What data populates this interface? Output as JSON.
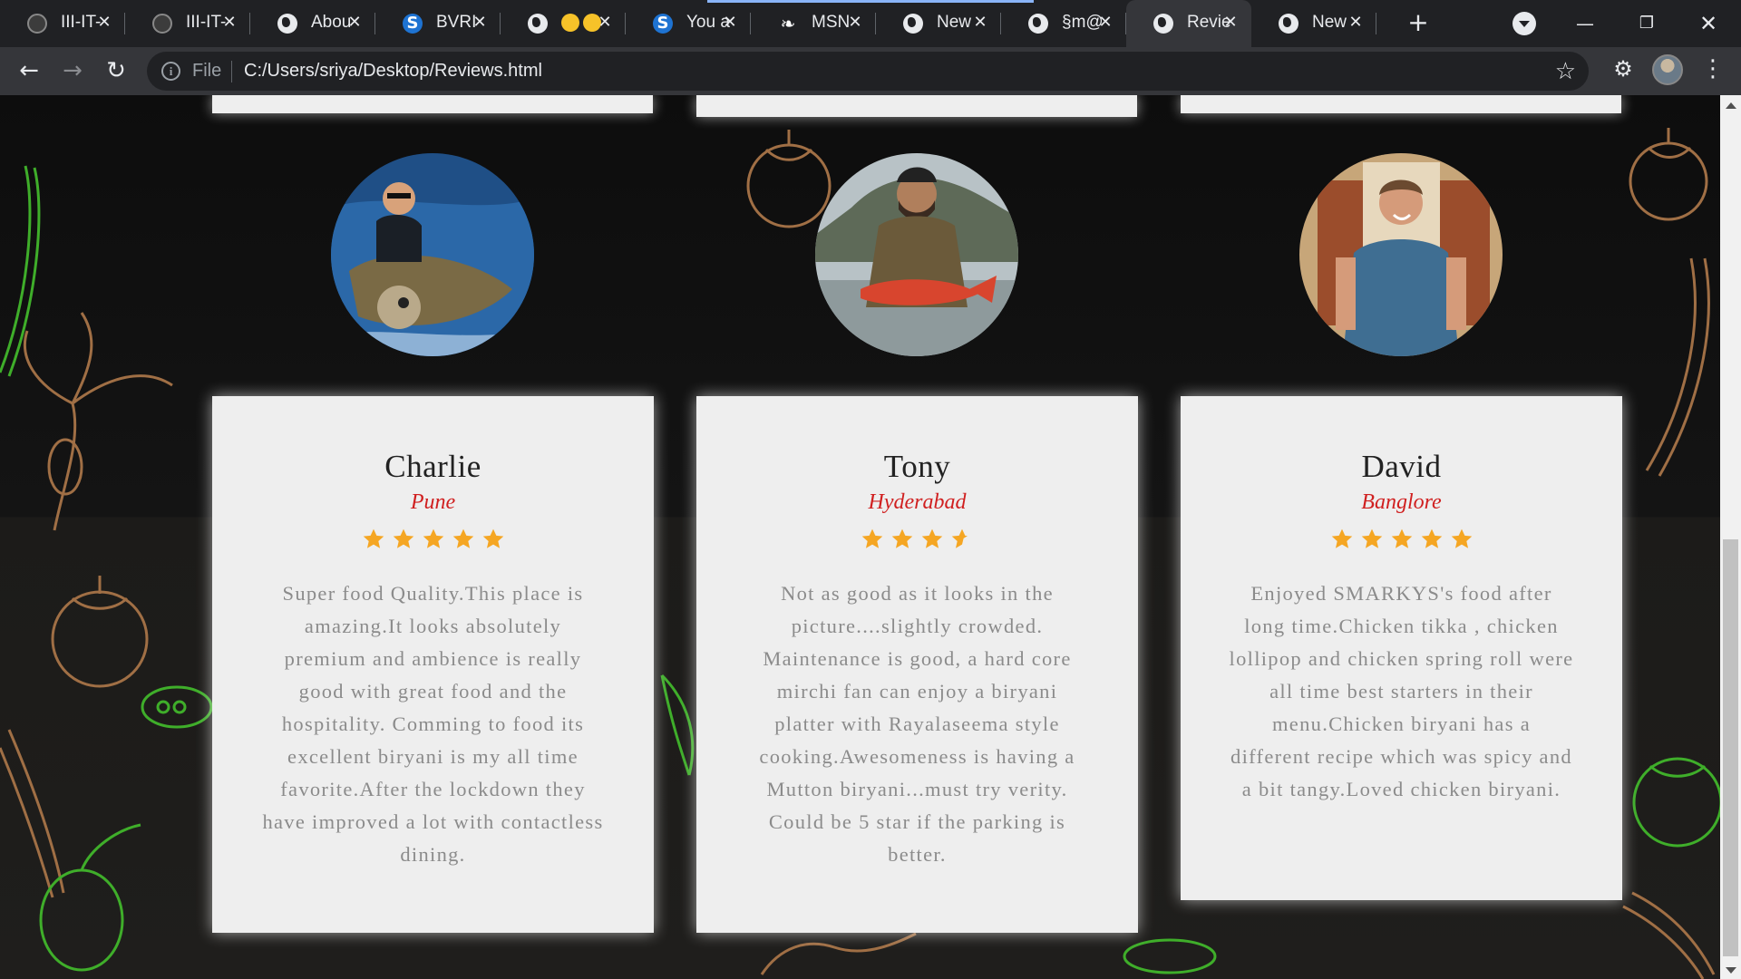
{
  "browser": {
    "tabs": [
      {
        "title": "III-IT-",
        "icon": "github-icon"
      },
      {
        "title": "III-IT-",
        "icon": "github-icon"
      },
      {
        "title": "Abou",
        "icon": "globe-icon"
      },
      {
        "title": "BVRI",
        "icon": "s-logo-icon"
      },
      {
        "title": "",
        "icon": "globe-icon",
        "emoji": true
      },
      {
        "title": "You a",
        "icon": "s-logo-icon"
      },
      {
        "title": "MSN",
        "icon": "msn-icon"
      },
      {
        "title": "New",
        "icon": "globe-icon"
      },
      {
        "title": "§m@",
        "icon": "globe-icon"
      },
      {
        "title": "Revie",
        "icon": "globe-icon",
        "active": true
      },
      {
        "title": "New",
        "icon": "globe-icon"
      }
    ],
    "address": {
      "scheme_label": "File",
      "url": "C:/Users/sriya/Desktop/Reviews.html"
    }
  },
  "reviews": [
    {
      "name": "Charlie",
      "city": "Pune",
      "rating": 5,
      "text": "Super food Quality.This place is amazing.It looks absolutely premium and ambience is really good with great food and the hospitality. Comming to food its excellent biryani is my all time favorite.After the lockdown they have improved a lot with contactless dining."
    },
    {
      "name": "Tony",
      "city": "Hyderabad",
      "rating": 3.5,
      "text": "Not as good as it looks in the picture....slightly crowded. Maintenance is good, a hard core mirchi fan can enjoy a biryani platter with Rayalaseema style cooking.Awesomeness is having a Mutton biryani...must try verity. Could be 5 star if the parking is better."
    },
    {
      "name": "David",
      "city": "Banglore",
      "rating": 5,
      "text": "Enjoyed SMARKYS's food after long time.Chicken tikka , chicken lollipop and chicken spring roll were all time best starters in their menu.Chicken biryani has a different recipe which was spicy and a bit tangy.Loved chicken biryani."
    }
  ],
  "colors": {
    "star": "#f5a623",
    "city": "#d01f1f",
    "card": "#eeeeee"
  }
}
